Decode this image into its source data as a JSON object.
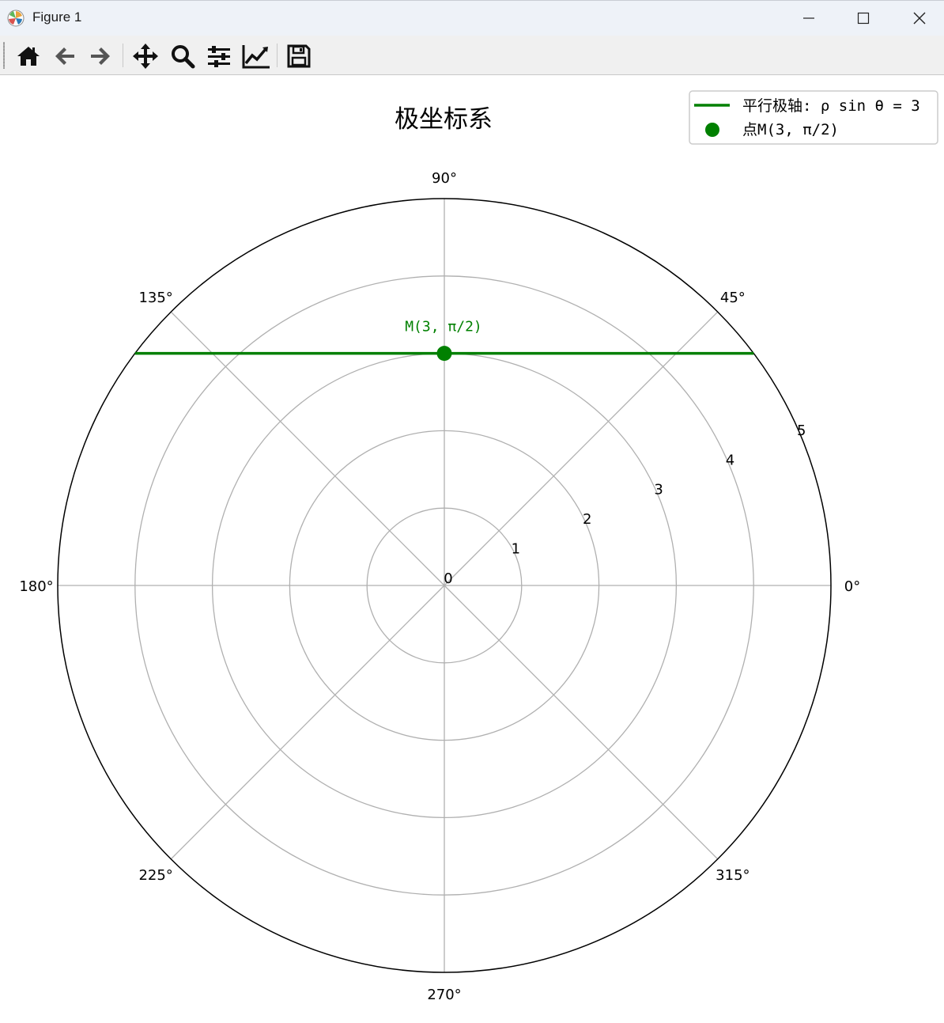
{
  "window": {
    "title": "Figure 1"
  },
  "toolbar": {
    "buttons": [
      {
        "name": "home-button",
        "icon": "home-icon"
      },
      {
        "name": "back-button",
        "icon": "arrow-left-icon"
      },
      {
        "name": "forward-button",
        "icon": "arrow-right-icon"
      },
      {
        "name": "pan-button",
        "icon": "move-icon"
      },
      {
        "name": "zoom-button",
        "icon": "magnifier-icon"
      },
      {
        "name": "configure-subplots-button",
        "icon": "sliders-icon"
      },
      {
        "name": "edit-axes-button",
        "icon": "line-chart-icon"
      },
      {
        "name": "save-button",
        "icon": "floppy-disk-icon"
      }
    ]
  },
  "colors": {
    "line": "#008000",
    "grid": "#b0b0b0",
    "frame": "#000000"
  },
  "chart_data": {
    "type": "line",
    "projection": "polar",
    "title": "极坐标系",
    "theta_ticks": [
      "0°",
      "45°",
      "90°",
      "135°",
      "180°",
      "225°",
      "270°",
      "315°"
    ],
    "r_ticks": [
      "0",
      "1",
      "2",
      "3",
      "4",
      "5"
    ],
    "rlim": [
      0,
      5
    ],
    "r_label_angle_deg": 22.5,
    "grid": true,
    "series": [
      {
        "name": "平行极轴: ρ sin θ = 3",
        "kind": "line",
        "equation": "r*sin(theta)=3",
        "theta_range_deg": [
          36.87,
          143.13
        ],
        "color": "#008000"
      },
      {
        "name": "点M(3, π/2)",
        "kind": "point",
        "r": 3,
        "theta_deg": 90,
        "color": "#008000"
      }
    ],
    "annotations": [
      {
        "text": "M(3, π/2)",
        "r": 3,
        "theta_deg": 90,
        "color": "#008000"
      }
    ],
    "legend": {
      "position": "top-right"
    }
  }
}
